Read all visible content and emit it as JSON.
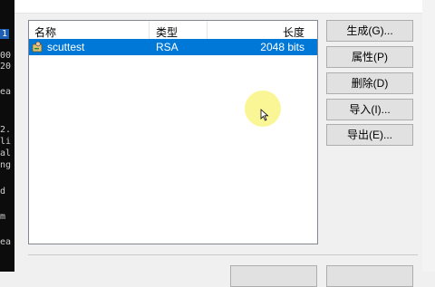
{
  "terminal": {
    "lines": [
      "1",
      "00",
      "20",
      "ea",
      "2.",
      "li",
      "al",
      "ng",
      "d",
      "m",
      "ea"
    ]
  },
  "dialog": {
    "title": "",
    "list": {
      "headers": {
        "name": "名称",
        "type": "类型",
        "length": "长度"
      },
      "rows": [
        {
          "name": "scuttest",
          "type": "RSA",
          "length": "2048 bits",
          "icon": "key-user-icon"
        }
      ]
    },
    "buttons": {
      "generate": "生成(G)...",
      "properties": "属性(P)",
      "delete": "删除(D)",
      "import": "导入(I)...",
      "export": "导出(E)..."
    }
  },
  "colors": {
    "selection": "#0078d7",
    "dialog_bg": "#f0f0f0",
    "cursor_highlight": "#f8f182"
  }
}
